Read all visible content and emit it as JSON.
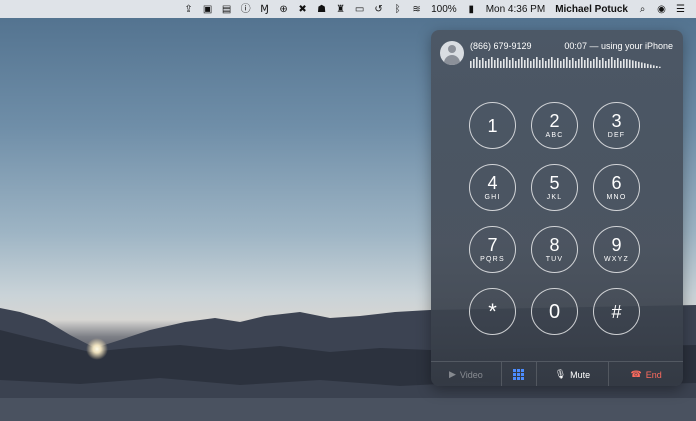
{
  "menubar": {
    "battery_percent": "100%",
    "clock": "Mon 4:36 PM",
    "user": "Michael Potuck",
    "icons": [
      "tool-icon",
      "app-grid-icon",
      "save-icon",
      "info-icon",
      "malwarebytes-icon",
      "upload-icon",
      "xcode-icon",
      "dock-icon",
      "cleaning-icon",
      "airplay-icon",
      "time-machine-icon",
      "bluetooth-icon",
      "wifi-icon",
      "battery-icon",
      "search-icon",
      "siri-icon",
      "notification-center-icon"
    ]
  },
  "call": {
    "number": "(866) 679-9129",
    "status": "00:07 — using your iPhone"
  },
  "keypad": {
    "keys": [
      {
        "digit": "1",
        "letters": ""
      },
      {
        "digit": "2",
        "letters": "ABC"
      },
      {
        "digit": "3",
        "letters": "DEF"
      },
      {
        "digit": "4",
        "letters": "GHI"
      },
      {
        "digit": "5",
        "letters": "JKL"
      },
      {
        "digit": "6",
        "letters": "MNO"
      },
      {
        "digit": "7",
        "letters": "PQRS"
      },
      {
        "digit": "8",
        "letters": "TUV"
      },
      {
        "digit": "9",
        "letters": "WXYZ"
      },
      {
        "digit": "*",
        "letters": ""
      },
      {
        "digit": "0",
        "letters": ""
      },
      {
        "digit": "#",
        "letters": ""
      }
    ]
  },
  "controls": {
    "video_label": "Video",
    "mute_label": "Mute",
    "end_label": "End",
    "end_color": "#ff6b5e",
    "dialpad_color": "#4c8dff"
  }
}
